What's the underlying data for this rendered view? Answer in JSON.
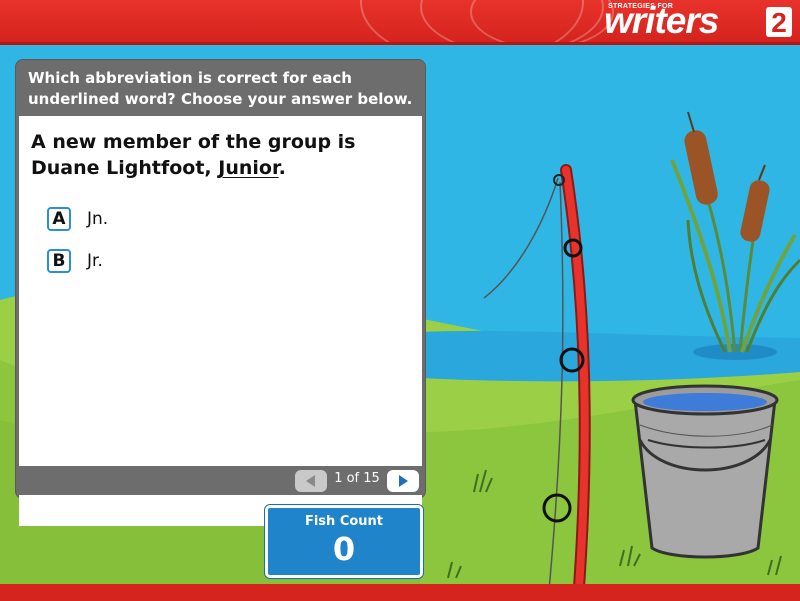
{
  "header": {
    "logo_small": "STRATEGIES FOR",
    "logo_word": "writers",
    "logo_number": "2"
  },
  "question_panel": {
    "instruction": "Which abbreviation is correct for each underlined word? Choose your answer below.",
    "question_before": "A new member of the group is Duane Lightfoot, ",
    "question_underlined": "Junior",
    "question_after": ".",
    "options": [
      {
        "key": "A",
        "text": "Jn."
      },
      {
        "key": "B",
        "text": "Jr."
      }
    ]
  },
  "pager": {
    "label": "1 of 15",
    "prev_icon": "triangle-left-icon",
    "next_icon": "triangle-right-icon"
  },
  "fish_count": {
    "label": "Fish Count",
    "value": "0"
  },
  "colors": {
    "sky": "#2fb6e4",
    "header_red": "#d5231d",
    "grass": "#8cc63f",
    "panel_gray": "#6d6d6d",
    "accent_blue": "#1f84c9",
    "rod_red": "#e8332c"
  }
}
